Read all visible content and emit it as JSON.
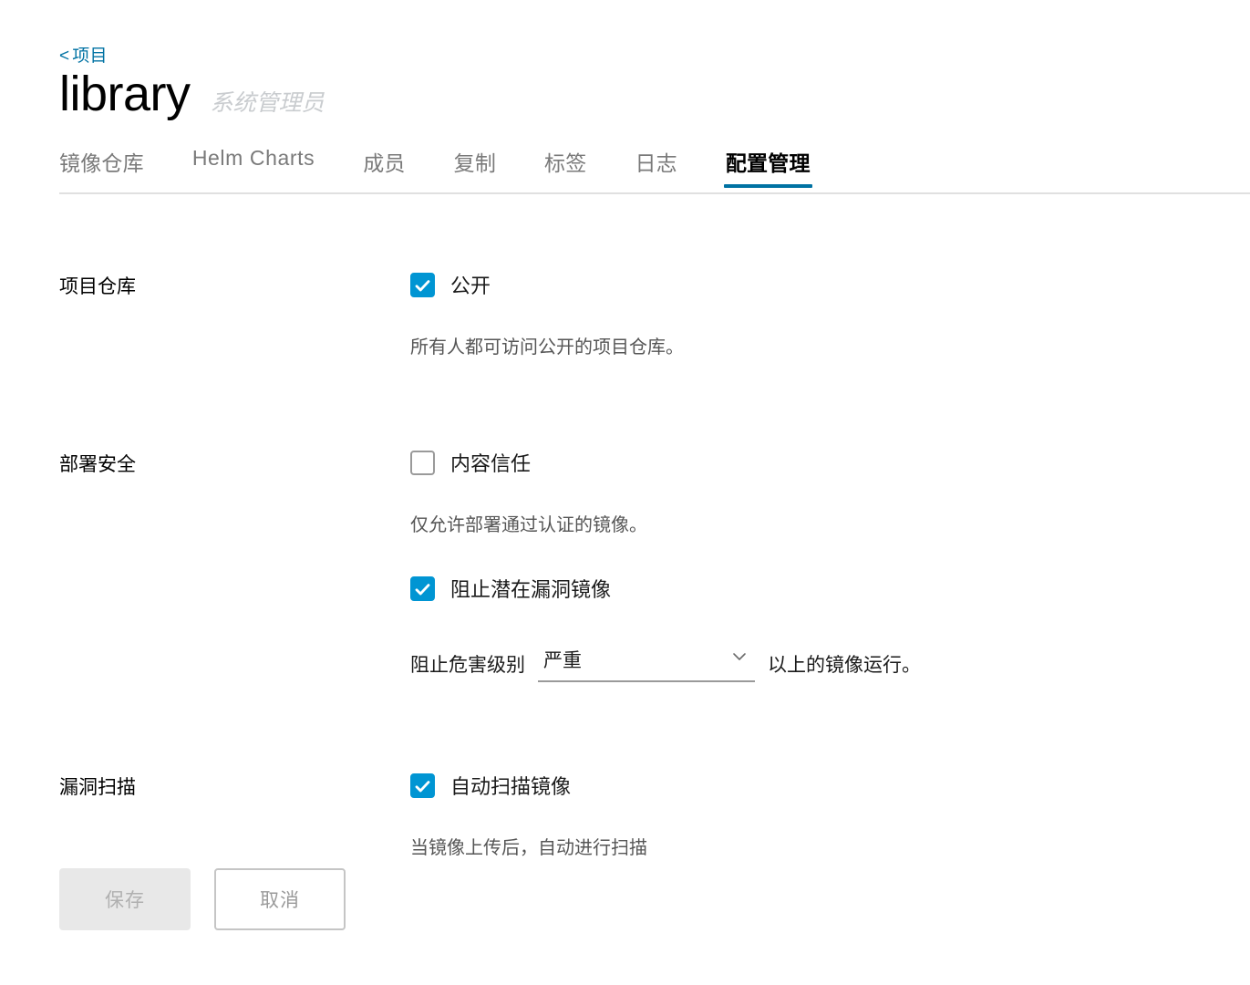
{
  "header": {
    "breadcrumb_chevron": "<",
    "breadcrumb_label": "项目",
    "project_title": "library",
    "project_role": "系统管理员"
  },
  "tabs": [
    {
      "label": "镜像仓库",
      "active": false
    },
    {
      "label": "Helm Charts",
      "active": false
    },
    {
      "label": "成员",
      "active": false
    },
    {
      "label": "复制",
      "active": false
    },
    {
      "label": "标签",
      "active": false
    },
    {
      "label": "日志",
      "active": false
    },
    {
      "label": "配置管理",
      "active": true
    }
  ],
  "form": {
    "project_repo": {
      "label": "项目仓库",
      "public_checkbox_label": "公开",
      "public_checked": true,
      "public_helper": "所有人都可访问公开的项目仓库。"
    },
    "deploy_security": {
      "label": "部署安全",
      "content_trust_label": "内容信任",
      "content_trust_checked": false,
      "content_trust_helper": "仅允许部署通过认证的镜像。",
      "prevent_vulnerable_label": "阻止潜在漏洞镜像",
      "prevent_vulnerable_checked": true,
      "severity_prefix": "阻止危害级别",
      "severity_value": "严重",
      "severity_suffix": "以上的镜像运行。"
    },
    "vulnerability_scan": {
      "label": "漏洞扫描",
      "auto_scan_label": "自动扫描镜像",
      "auto_scan_checked": true,
      "auto_scan_helper": "当镜像上传后，自动进行扫描"
    }
  },
  "actions": {
    "save_label": "保存",
    "cancel_label": "取消"
  },
  "colors": {
    "accent_blue": "#0095d3",
    "link_blue": "#0072a3",
    "tab_underline": "#0072a3",
    "helper_text": "#565656",
    "muted": "#c9cccf"
  }
}
